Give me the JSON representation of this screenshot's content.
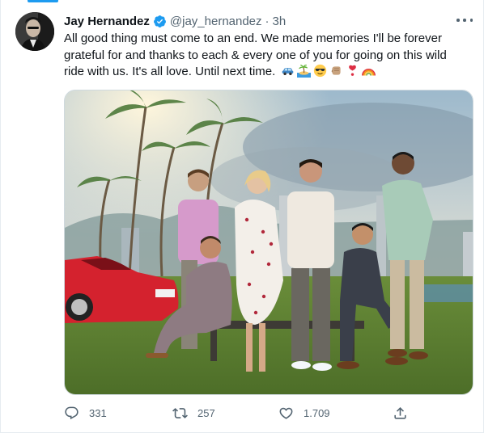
{
  "tweet": {
    "author_name": "Jay Hernandez",
    "handle": "@jay_hernandez",
    "separator": "·",
    "time": "3h",
    "text": "All good thing must come to an end. We made memories I'll be forever grateful for and thanks to each & every one of you for going on this wild ride with us. It's all love. Until next time.",
    "emojis": [
      "car-icon",
      "island-icon",
      "sunglasses-face-icon",
      "fist-icon",
      "heart-exclamation-icon",
      "rainbow-icon"
    ]
  },
  "actions": {
    "reply_count": "331",
    "retweet_count": "257",
    "like_count": "1.709"
  },
  "colors": {
    "accent": "#1d9bf0",
    "text_primary": "#0f1419",
    "text_secondary": "#536471",
    "border": "#cfd9de"
  }
}
